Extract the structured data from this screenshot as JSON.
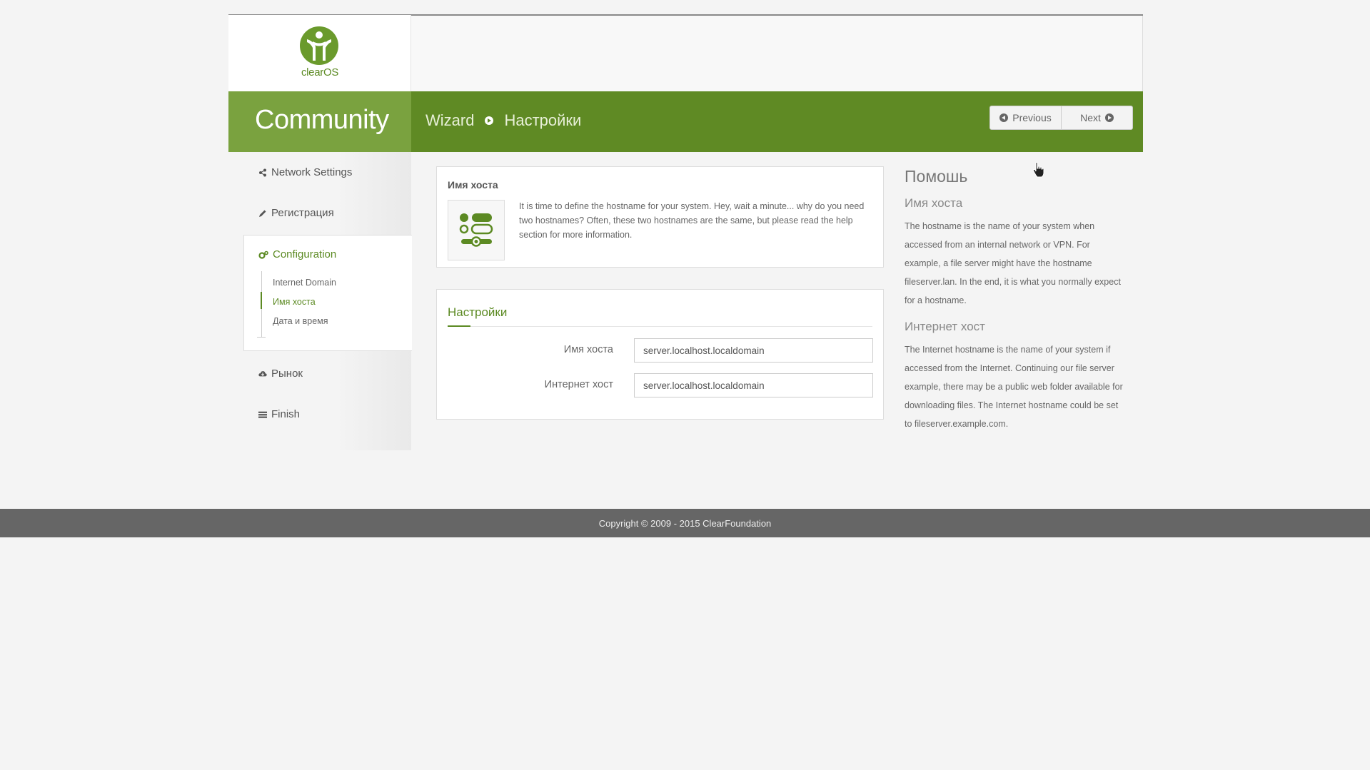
{
  "brand": {
    "logo_text": "clearOS",
    "edition": "Community"
  },
  "breadcrumb": {
    "root": "Wizard",
    "current": "Настройки"
  },
  "nav": {
    "previous_label": "Previous",
    "next_label": "Next"
  },
  "sidebar": {
    "items": [
      {
        "label": "Network Settings",
        "icon": "share-icon"
      },
      {
        "label": "Регистрация",
        "icon": "pencil-icon"
      },
      {
        "label": "Configuration",
        "icon": "gears-icon"
      },
      {
        "label": "Рынок",
        "icon": "cloud-download-icon"
      },
      {
        "label": "Finish",
        "icon": "list-icon"
      }
    ],
    "sub_items": [
      {
        "label": "Internet Domain"
      },
      {
        "label": "Имя хоста"
      },
      {
        "label": "Дата и время"
      }
    ]
  },
  "intro": {
    "title": "Имя хоста",
    "text": "It is time to define the hostname for your system. Hey, wait a minute... why do you need two hostnames? Often, these two hostnames are the same, but please read the help section for more information."
  },
  "settings": {
    "title": "Настройки",
    "fields": [
      {
        "label": "Имя хоста",
        "value": "server.localhost.localdomain"
      },
      {
        "label": "Интернет хост",
        "value": "server.localhost.localdomain"
      }
    ]
  },
  "help": {
    "title": "Помошь",
    "sections": [
      {
        "heading": "Имя хоста",
        "text": "The hostname is the name of your system when accessed from an internal network or VPN. For example, a file server might have the hostname fileserver.lan. In the end, it is what you normally expect for a hostname."
      },
      {
        "heading": "Интернет хост",
        "text": "The Internet hostname is the name of your system if accessed from the Internet. Continuing our file server example, there may be a public web folder available for downloading files. The Internet hostname could be set to fileserver.example.com."
      }
    ]
  },
  "footer": {
    "copyright": "Copyright © 2009 - 2015 ClearFoundation"
  },
  "colors": {
    "accent": "#5c8a23",
    "banner": "#5f8a24",
    "banner_left": "#7aa23f",
    "footer": "#666666"
  }
}
